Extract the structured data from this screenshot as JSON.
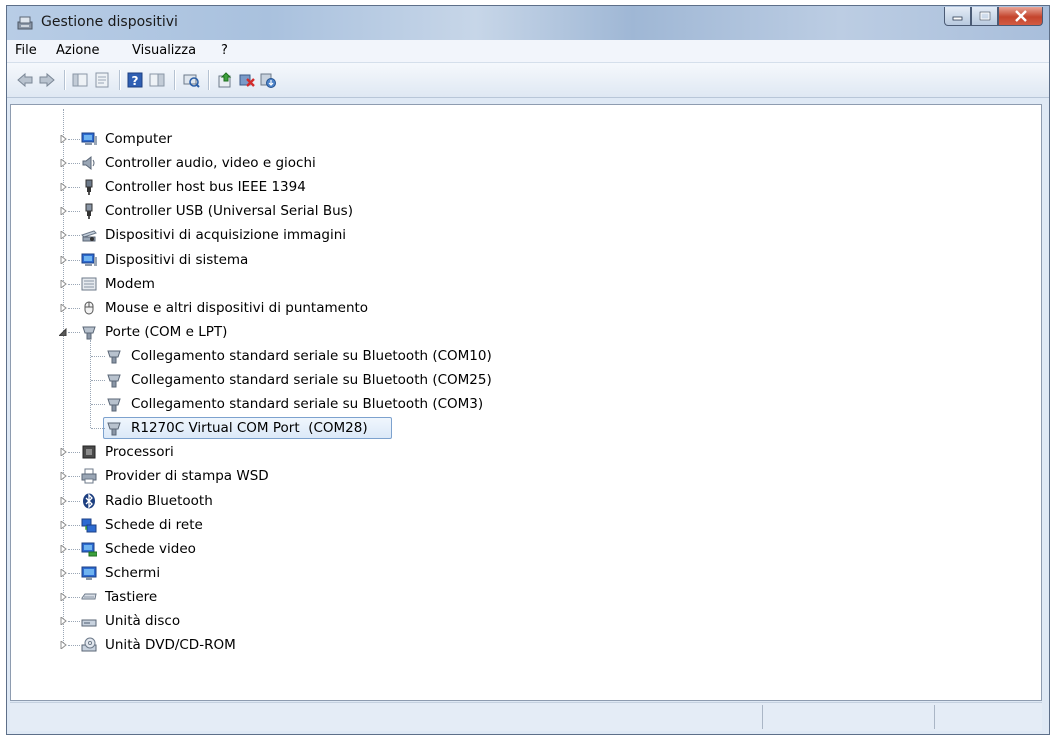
{
  "window": {
    "title": "Gestione dispositivi"
  },
  "menu": {
    "file": "File",
    "azione": "Azione",
    "visualizza": "Visualizza",
    "help": "?"
  },
  "tree": {
    "categories": [
      {
        "label": "Computer",
        "icon": "computer-icon"
      },
      {
        "label": "Controller audio, video e giochi",
        "icon": "speaker-icon"
      },
      {
        "label": "Controller host bus IEEE 1394",
        "icon": "firewire-plug-icon"
      },
      {
        "label": "Controller USB (Universal Serial Bus)",
        "icon": "usb-plug-icon"
      },
      {
        "label": "Dispositivi di acquisizione immagini",
        "icon": "scanner-icon"
      },
      {
        "label": "Dispositivi di sistema",
        "icon": "system-devices-icon"
      },
      {
        "label": "Modem",
        "icon": "modem-icon"
      },
      {
        "label": "Mouse e altri dispositivi di puntamento",
        "icon": "mouse-icon"
      },
      {
        "label": "Porte (COM e LPT)",
        "icon": "port-icon",
        "expanded": true
      },
      {
        "label": "Processori",
        "icon": "processor-icon"
      },
      {
        "label": "Provider di stampa WSD",
        "icon": "printer-icon"
      },
      {
        "label": "Radio Bluetooth",
        "icon": "bluetooth-icon"
      },
      {
        "label": "Schede di rete",
        "icon": "network-adapter-icon"
      },
      {
        "label": "Schede video",
        "icon": "display-adapter-icon"
      },
      {
        "label": "Schermi",
        "icon": "monitor-icon"
      },
      {
        "label": "Tastiere",
        "icon": "keyboard-icon"
      },
      {
        "label": "Unità disco",
        "icon": "disk-drive-icon"
      },
      {
        "label": "Unità DVD/CD-ROM",
        "icon": "dvd-drive-icon"
      }
    ],
    "ports": [
      {
        "label": "Collegamento standard seriale su Bluetooth (COM10)"
      },
      {
        "label": "Collegamento standard seriale su Bluetooth (COM25)"
      },
      {
        "label": "Collegamento standard seriale su Bluetooth (COM3)"
      },
      {
        "label": "R1270C Virtual COM Port  (COM28)",
        "selected": true
      }
    ]
  }
}
